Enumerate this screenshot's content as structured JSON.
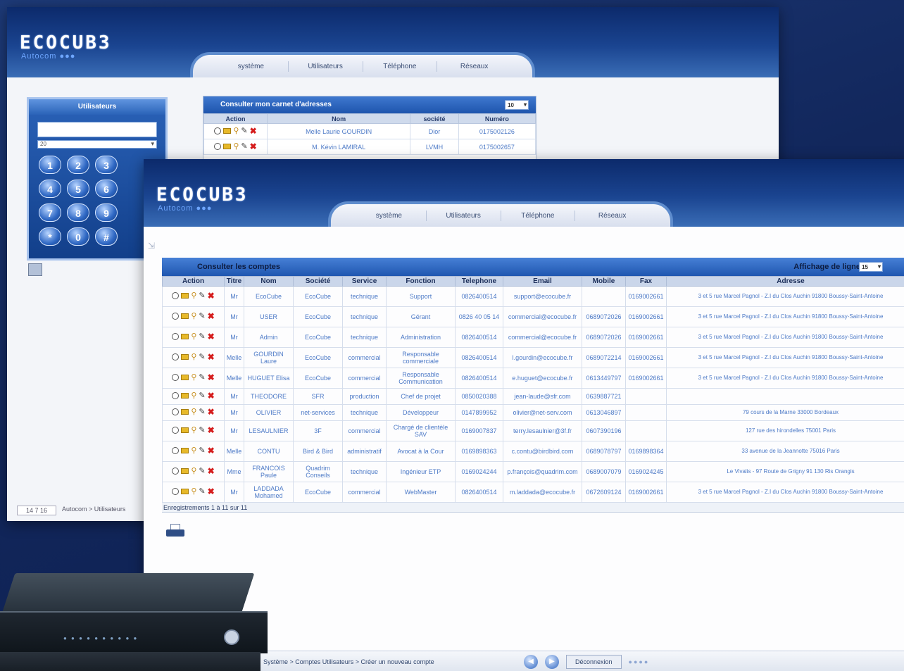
{
  "back_window": {
    "logo": "ECOCUB3",
    "logo_sub": "Autocom ●●●",
    "tabs": [
      "système",
      "Utilisateurs",
      "Téléphone",
      "Réseaux"
    ],
    "dialer": {
      "title": "Utilisateurs",
      "select_value": "20",
      "keys": [
        "1",
        "2",
        "3",
        "4",
        "5",
        "6",
        "7",
        "8",
        "9",
        "*",
        "0",
        "#"
      ]
    },
    "address_book": {
      "title": "Consulter mon carnet d'adresses",
      "page_size": "10",
      "columns": [
        "Action",
        "Nom",
        "société",
        "Numéro"
      ],
      "rows": [
        {
          "name": "Melle Laurie GOURDIN",
          "company": "Dior",
          "number": "0175002126"
        },
        {
          "name": "M. Kévin LAMIRAL",
          "company": "LVMH",
          "number": "0175002657"
        }
      ]
    },
    "status": {
      "field": "14 7 16",
      "path": "Autocom > Utilisateurs"
    }
  },
  "front_window": {
    "logo": "ECOCUB3",
    "logo_sub": "Autocom ●●●",
    "tabs": [
      "système",
      "Utilisateurs",
      "Téléphone",
      "Réseaux"
    ],
    "grid": {
      "title": "Consulter les comptes",
      "lines_label": "Affichage de ligne",
      "lines_value": "15",
      "columns": [
        "Action",
        "Titre",
        "Nom",
        "Société",
        "Service",
        "Fonction",
        "Telephone",
        "Email",
        "Mobile",
        "Fax",
        "Adresse"
      ],
      "rows": [
        {
          "title": "Mr",
          "name": "EcoCube",
          "company": "EcoCube",
          "service": "technique",
          "function": "Support",
          "phone": "0826400514",
          "email": "support@ecocube.fr",
          "mobile": "",
          "fax": "0169002661",
          "address": "3 et 5 rue Marcel Pagnol - Z.I du Clos Auchin 91800 Boussy-Saint-Antoine"
        },
        {
          "title": "Mr",
          "name": "USER",
          "company": "EcoCube",
          "service": "technique",
          "function": "Gérant",
          "phone": "0826 40 05 14",
          "email": "commercial@ecocube.fr",
          "mobile": "0689072026",
          "fax": "0169002661",
          "address": "3 et 5 rue Marcel Pagnol - Z.I du Clos Auchin 91800 Boussy-Saint-Antoine"
        },
        {
          "title": "Mr",
          "name": "Admin",
          "company": "EcoCube",
          "service": "technique",
          "function": "Administration",
          "phone": "0826400514",
          "email": "commercial@ecocube.fr",
          "mobile": "0689072026",
          "fax": "0169002661",
          "address": "3 et 5 rue Marcel Pagnol - Z.I du Clos Auchin 91800 Boussy-Saint-Antoine"
        },
        {
          "title": "Melle",
          "name": "GOURDIN Laure",
          "company": "EcoCube",
          "service": "commercial",
          "function": "Responsable commerciale",
          "phone": "0826400514",
          "email": "l.gourdin@ecocube.fr",
          "mobile": "0689072214",
          "fax": "0169002661",
          "address": "3 et 5 rue Marcel Pagnol - Z.I du Clos Auchin 91800 Boussy-Saint-Antoine"
        },
        {
          "title": "Melle",
          "name": "HUGUET Elisa",
          "company": "EcoCube",
          "service": "commercial",
          "function": "Responsable Communication",
          "phone": "0826400514",
          "email": "e.huguet@ecocube.fr",
          "mobile": "0613449797",
          "fax": "0169002661",
          "address": "3 et 5 rue Marcel Pagnol - Z.I du Clos Auchin 91800 Boussy-Saint-Antoine"
        },
        {
          "title": "Mr",
          "name": "THEODORE",
          "company": "SFR",
          "service": "production",
          "function": "Chef de projet",
          "phone": "0850020388",
          "email": "jean-laude@sfr.com",
          "mobile": "0639887721",
          "fax": "",
          "address": ""
        },
        {
          "title": "Mr",
          "name": "OLIVIER",
          "company": "net-services",
          "service": "technique",
          "function": "Développeur",
          "phone": "0147899952",
          "email": "olivier@net-serv.com",
          "mobile": "0613046897",
          "fax": "",
          "address": "79 cours de la Marne 33000 Bordeaux"
        },
        {
          "title": "Mr",
          "name": "LESAULNIER",
          "company": "3F",
          "service": "commercial",
          "function": "Chargé de clientèle SAV",
          "phone": "0169007837",
          "email": "terry.lesaulnier@3f.fr",
          "mobile": "0607390196",
          "fax": "",
          "address": "127 rue des hirondelles 75001 Paris"
        },
        {
          "title": "Melle",
          "name": "CONTU",
          "company": "Bird & Bird",
          "service": "administratif",
          "function": "Avocat à la Cour",
          "phone": "0169898363",
          "email": "c.contu@birdbird.com",
          "mobile": "0689078797",
          "fax": "0169898364",
          "address": "33 avenue de la Jeannotte 75016 Paris"
        },
        {
          "title": "Mme",
          "name": "FRANCOIS Paule",
          "company": "Quadrim Conseils",
          "service": "technique",
          "function": "Ingénieur ETP",
          "phone": "0169024244",
          "email": "p.françois@quadrim.com",
          "mobile": "0689007079",
          "fax": "0169024245",
          "address": "Le Vivalis - 97 Route de Grigny 91 130 Ris Orangis"
        },
        {
          "title": "Mr",
          "name": "LADDADA Mohamed",
          "company": "EcoCube",
          "service": "commercial",
          "function": "WebMaster",
          "phone": "0826400514",
          "email": "m.laddada@ecocube.fr",
          "mobile": "0672609124",
          "fax": "0169002661",
          "address": "3 et 5 rue Marcel Pagnol - Z.I du Clos Auchin 91800 Boussy-Saint-Antoine"
        }
      ],
      "footer": "Enregistrements 1 à 11 sur 11"
    },
    "status": {
      "path": "Système > Comptes Utilisateurs > Créer un nouveau compte",
      "logout": "Déconnexion",
      "dots": "●●●●"
    }
  }
}
